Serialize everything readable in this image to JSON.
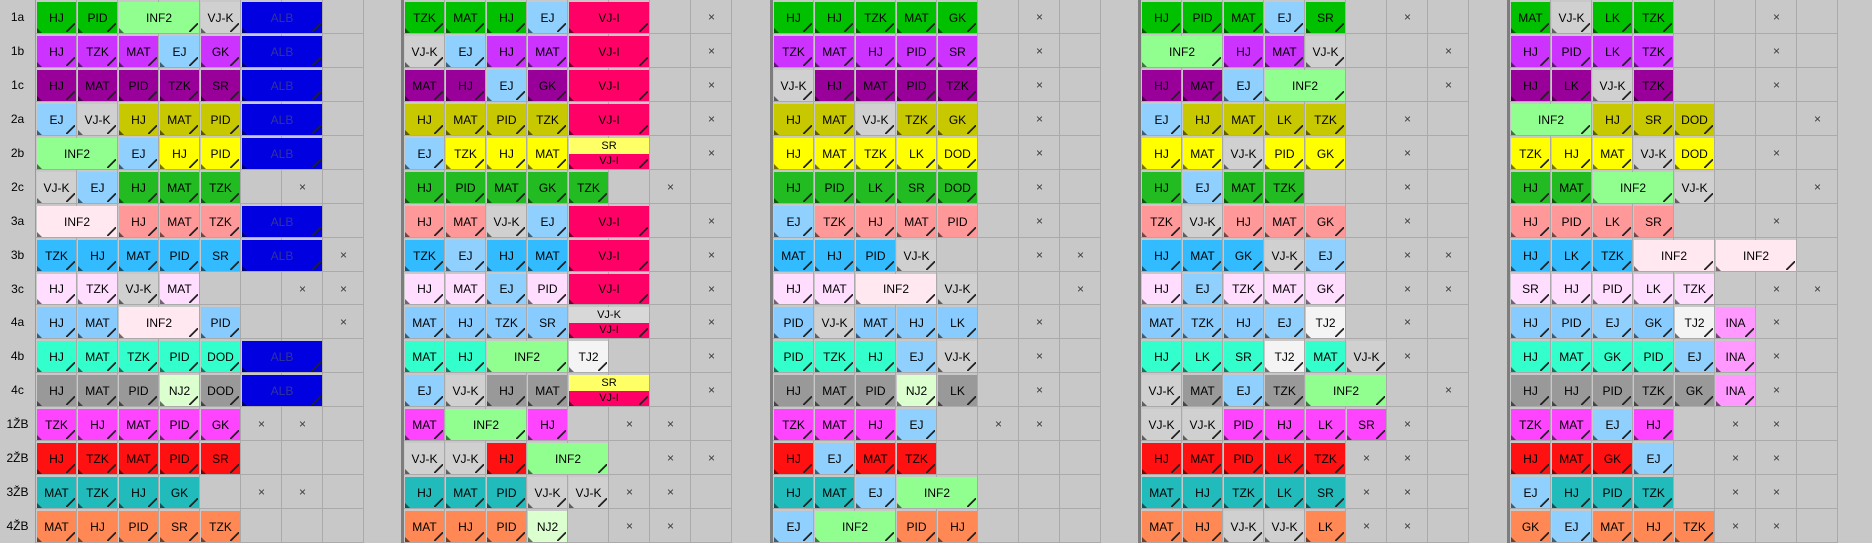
{
  "colors": {
    "HJ": "#cc00cc",
    "PID": "#cc00cc",
    "INF2": "#90ff90",
    "VJ-K": "#d0d0d0",
    "ALB": "#0000e0",
    "TZK": "#cc00cc",
    "MAT": "#cc00cc",
    "EJ": "#8fd0ff",
    "VJ-I": "#ff0066",
    "GK": "#cc00cc",
    "SR": "#cc00cc",
    "LK": "#cc00cc",
    "DOD": "#cc00cc",
    "NJ2": "#d8ffd8",
    "TJ2": "#f8f8f8",
    "INA": "#ff88ff"
  },
  "rows": [
    {
      "label": "1a",
      "theme": "#00c000"
    },
    {
      "label": "1b",
      "theme": "#cc33ff"
    },
    {
      "label": "1c",
      "theme": "#990099"
    },
    {
      "label": "2a",
      "theme": "#c8c800"
    },
    {
      "label": "2b",
      "theme": "#ffff00"
    },
    {
      "label": "2c",
      "theme": "#22bb22"
    },
    {
      "label": "3a",
      "theme": "#ff9999"
    },
    {
      "label": "3b",
      "theme": "#33bbff"
    },
    {
      "label": "3c",
      "theme": "#ffddff"
    },
    {
      "label": "4a",
      "theme": "#88ccff"
    },
    {
      "label": "4b",
      "theme": "#33ffcc"
    },
    {
      "label": "4c",
      "theme": "#999999"
    },
    {
      "label": "1ŽB",
      "theme": "#ff44ff"
    },
    {
      "label": "2ŽB",
      "theme": "#ff1111"
    },
    {
      "label": "3ŽB",
      "theme": "#22bbbb"
    },
    {
      "label": "4ŽB",
      "theme": "#ff8855"
    }
  ],
  "days": [
    {
      "rows": [
        [
          "HJ",
          "PID",
          "INF2",
          "VJ-K",
          "ALB",
          "",
          "",
          ""
        ],
        [
          "HJ",
          "TZK",
          "MAT",
          "EJ",
          "GK",
          "ALB",
          "",
          ""
        ],
        [
          "HJ",
          "MAT",
          "PID",
          "TZK",
          "SR",
          "ALB",
          "",
          ""
        ],
        [
          "EJ",
          "VJ-K",
          "HJ",
          "MAT",
          "PID",
          "ALB",
          "",
          ""
        ],
        [
          "INF2",
          "EJ",
          "HJ",
          "PID",
          "ALB",
          "",
          "",
          ""
        ],
        [
          "VJ-K",
          "EJ",
          "HJ",
          "MAT",
          "TZK",
          "",
          "x",
          ""
        ],
        [
          "INF2",
          "HJ",
          "MAT",
          "TZK",
          "ALB",
          "",
          "",
          ""
        ],
        [
          "TZK",
          "HJ",
          "MAT",
          "PID",
          "SR",
          "ALB",
          "x",
          "x"
        ],
        [
          "HJ",
          "TZK",
          "VJ-K",
          "MAT",
          "",
          "",
          "x",
          "x"
        ],
        [
          "HJ",
          "MAT",
          "INF2",
          "PID",
          "",
          "",
          "x",
          ""
        ],
        [
          "HJ",
          "MAT",
          "TZK",
          "PID",
          "DOD",
          "ALB",
          "",
          ""
        ],
        [
          "HJ",
          "MAT",
          "PID",
          "NJ2",
          "DOD",
          "ALB",
          "",
          ""
        ],
        [
          "TZK",
          "HJ",
          "MAT",
          "PID",
          "GK",
          "x",
          "x",
          ""
        ],
        [
          "HJ",
          "TZK",
          "MAT",
          "PID",
          "SR",
          "",
          "",
          ""
        ],
        [
          "MAT",
          "TZK",
          "HJ",
          "GK",
          "",
          "x",
          "x",
          ""
        ],
        [
          "MAT",
          "HJ",
          "PID",
          "SR",
          "TZK",
          "",
          "",
          ""
        ]
      ]
    },
    {
      "rows": [
        [
          "TZK",
          "MAT",
          "HJ",
          "EJ",
          "VJ-I",
          "",
          "x",
          ""
        ],
        [
          "VJ-K",
          "EJ",
          "HJ",
          "MAT",
          "VJ-I",
          "",
          "x",
          ""
        ],
        [
          "MAT",
          "HJ",
          "EJ",
          "GK",
          "VJ-I",
          "",
          "x",
          ""
        ],
        [
          "HJ",
          "MAT",
          "PID",
          "TZK",
          "VJ-I",
          "",
          "x",
          ""
        ],
        [
          "EJ",
          "TZK",
          "HJ",
          "MAT",
          "SR/VJ-I",
          "",
          "x",
          ""
        ],
        [
          "HJ",
          "PID",
          "MAT",
          "GK",
          "TZK",
          "",
          "x",
          ""
        ],
        [
          "HJ",
          "MAT",
          "VJ-K",
          "EJ",
          "VJ-I",
          "",
          "x",
          ""
        ],
        [
          "TZK",
          "EJ",
          "HJ",
          "MAT",
          "VJ-I",
          "",
          "x",
          "x"
        ],
        [
          "HJ",
          "MAT",
          "EJ",
          "PID",
          "VJ-I",
          "",
          "x",
          "x"
        ],
        [
          "MAT",
          "HJ",
          "TZK",
          "SR",
          "VJ-K/VJ-I",
          "",
          "x",
          ""
        ],
        [
          "MAT",
          "HJ",
          "INF2",
          "TJ2",
          "",
          "",
          "x",
          ""
        ],
        [
          "EJ",
          "VJ-K",
          "HJ",
          "MAT",
          "SR/VJ-I",
          "",
          "x",
          ""
        ],
        [
          "MAT",
          "INF2",
          "HJ",
          "",
          "x",
          "x",
          "",
          ""
        ],
        [
          "VJ-K",
          "VJ-K",
          "HJ",
          "INF2",
          "",
          "x",
          "x",
          ""
        ],
        [
          "HJ",
          "MAT",
          "PID",
          "VJ-K",
          "VJ-K",
          "x",
          "x",
          ""
        ],
        [
          "MAT",
          "HJ",
          "PID",
          "NJ2",
          "",
          "x",
          "x",
          ""
        ]
      ]
    },
    {
      "rows": [
        [
          "HJ",
          "HJ",
          "TZK",
          "MAT",
          "GK",
          "",
          "x",
          ""
        ],
        [
          "TZK",
          "MAT",
          "HJ",
          "PID",
          "SR",
          "",
          "x",
          ""
        ],
        [
          "VJ-K",
          "HJ",
          "MAT",
          "PID",
          "TZK",
          "",
          "x",
          ""
        ],
        [
          "HJ",
          "MAT",
          "VJ-K",
          "TZK",
          "GK",
          "",
          "x",
          ""
        ],
        [
          "HJ",
          "MAT",
          "TZK",
          "LK",
          "DOD",
          "",
          "x",
          ""
        ],
        [
          "HJ",
          "PID",
          "LK",
          "SR",
          "DOD",
          "",
          "x",
          ""
        ],
        [
          "EJ",
          "TZK",
          "HJ",
          "MAT",
          "PID",
          "",
          "x",
          ""
        ],
        [
          "MAT",
          "HJ",
          "PID",
          "VJ-K",
          "",
          "",
          "x",
          "x"
        ],
        [
          "HJ",
          "MAT",
          "INF2",
          "VJ-K",
          "",
          "",
          "x",
          "x"
        ],
        [
          "PID",
          "VJ-K",
          "MAT",
          "HJ",
          "LK",
          "",
          "x",
          ""
        ],
        [
          "PID",
          "TZK",
          "HJ",
          "EJ",
          "VJ-K",
          "",
          "x",
          ""
        ],
        [
          "HJ",
          "MAT",
          "PID",
          "NJ2",
          "LK",
          "",
          "x",
          ""
        ],
        [
          "TZK",
          "MAT",
          "HJ",
          "EJ",
          "",
          "x",
          "x",
          ""
        ],
        [
          "HJ",
          "EJ",
          "MAT",
          "TZK",
          "",
          "",
          "",
          ""
        ],
        [
          "HJ",
          "MAT",
          "EJ",
          "INF2",
          "",
          "",
          "",
          ""
        ],
        [
          "EJ",
          "INF2",
          "PID",
          "HJ",
          "",
          "",
          "",
          ""
        ]
      ]
    },
    {
      "rows": [
        [
          "HJ",
          "PID",
          "MAT",
          "EJ",
          "SR",
          "",
          "x",
          ""
        ],
        [
          "INF2",
          "HJ",
          "MAT",
          "VJ-K",
          "",
          "",
          "x",
          ""
        ],
        [
          "HJ",
          "MAT",
          "EJ",
          "INF2",
          "",
          "",
          "x",
          ""
        ],
        [
          "EJ",
          "HJ",
          "MAT",
          "LK",
          "TZK",
          "",
          "x",
          ""
        ],
        [
          "HJ",
          "MAT",
          "VJ-K",
          "PID",
          "GK",
          "",
          "x",
          ""
        ],
        [
          "HJ",
          "EJ",
          "MAT",
          "TZK",
          "",
          "",
          "x",
          ""
        ],
        [
          "TZK",
          "VJ-K",
          "HJ",
          "MAT",
          "GK",
          "",
          "x",
          ""
        ],
        [
          "HJ",
          "MAT",
          "GK",
          "VJ-K",
          "EJ",
          "",
          "x",
          "x"
        ],
        [
          "HJ",
          "EJ",
          "TZK",
          "MAT",
          "GK",
          "",
          "x",
          "x"
        ],
        [
          "MAT",
          "TZK",
          "HJ",
          "EJ",
          "TJ2",
          "",
          "x",
          ""
        ],
        [
          "HJ",
          "LK",
          "SR",
          "TJ2",
          "MAT",
          "VJ-K",
          "x",
          ""
        ],
        [
          "VJ-K",
          "MAT",
          "EJ",
          "TZK",
          "INF2",
          "",
          "x",
          ""
        ],
        [
          "VJ-K",
          "VJ-K",
          "PID",
          "HJ",
          "LK",
          "SR",
          "x",
          ""
        ],
        [
          "HJ",
          "MAT",
          "PID",
          "LK",
          "TZK",
          "x",
          "x",
          ""
        ],
        [
          "MAT",
          "HJ",
          "TZK",
          "LK",
          "SR",
          "x",
          "x",
          ""
        ],
        [
          "MAT",
          "HJ",
          "VJ-K",
          "VJ-K",
          "LK",
          "x",
          "x",
          ""
        ]
      ]
    },
    {
      "rows": [
        [
          "MAT",
          "VJ-K",
          "LK",
          "TZK",
          "",
          "",
          "x",
          ""
        ],
        [
          "HJ",
          "PID",
          "LK",
          "TZK",
          "",
          "",
          "x",
          ""
        ],
        [
          "HJ",
          "LK",
          "VJ-K",
          "TZK",
          "",
          "",
          "x",
          ""
        ],
        [
          "INF2",
          "HJ",
          "SR",
          "DOD",
          "",
          "",
          "x",
          ""
        ],
        [
          "TZK",
          "HJ",
          "MAT",
          "VJ-K",
          "DOD",
          "",
          "x",
          ""
        ],
        [
          "HJ",
          "MAT",
          "INF2",
          "VJ-K",
          "",
          "",
          "x",
          ""
        ],
        [
          "HJ",
          "PID",
          "LK",
          "SR",
          "",
          "",
          "x",
          ""
        ],
        [
          "HJ",
          "LK",
          "TZK",
          "INF2",
          "INF2",
          "",
          "x",
          "x"
        ],
        [
          "SR",
          "HJ",
          "PID",
          "LK",
          "TZK",
          "",
          "x",
          "x"
        ],
        [
          "HJ",
          "PID",
          "EJ",
          "GK",
          "TJ2",
          "INA",
          "x",
          ""
        ],
        [
          "HJ",
          "MAT",
          "GK",
          "PID",
          "EJ",
          "INA",
          "x",
          ""
        ],
        [
          "HJ",
          "HJ",
          "PID",
          "TZK",
          "GK",
          "INA",
          "x",
          ""
        ],
        [
          "TZK",
          "MAT",
          "EJ",
          "HJ",
          "",
          "x",
          "x",
          ""
        ],
        [
          "HJ",
          "MAT",
          "GK",
          "EJ",
          "",
          "x",
          "x",
          ""
        ],
        [
          "EJ",
          "HJ",
          "PID",
          "TZK",
          "",
          "x",
          "x",
          ""
        ],
        [
          "GK",
          "EJ",
          "MAT",
          "HJ",
          "TZK",
          "x",
          "x",
          ""
        ]
      ]
    }
  ]
}
